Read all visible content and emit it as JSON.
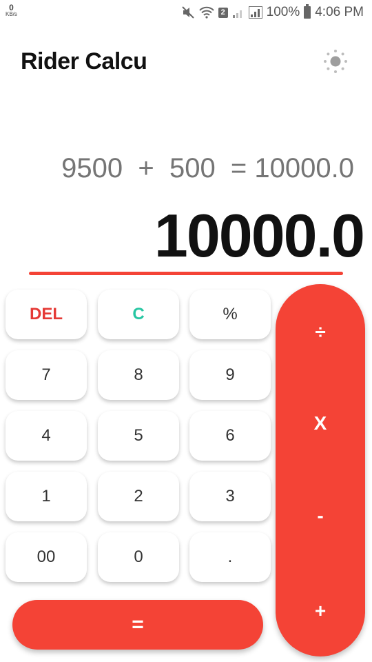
{
  "status_bar": {
    "net_speed_value": "0",
    "net_speed_unit": "KB/s",
    "sim_slot": "2",
    "battery": "100%",
    "time": "4:06 PM"
  },
  "app": {
    "title": "Rider Calcu",
    "theme_icon": "sun-icon"
  },
  "display": {
    "expression": "9500  +  500  = 10000.0",
    "result": "10000.0"
  },
  "keypad": {
    "del": "DEL",
    "clear": "C",
    "percent": "%",
    "seven": "7",
    "eight": "8",
    "nine": "9",
    "four": "4",
    "five": "5",
    "six": "6",
    "one": "1",
    "two": "2",
    "three": "3",
    "double_zero": "00",
    "zero": "0",
    "dot": ".",
    "equals": "="
  },
  "operators": {
    "divide": "÷",
    "multiply": "X",
    "subtract": "-",
    "add": "+"
  },
  "colors": {
    "accent": "#f44336",
    "clear_key": "#26c6a2",
    "del_key": "#e53935"
  }
}
